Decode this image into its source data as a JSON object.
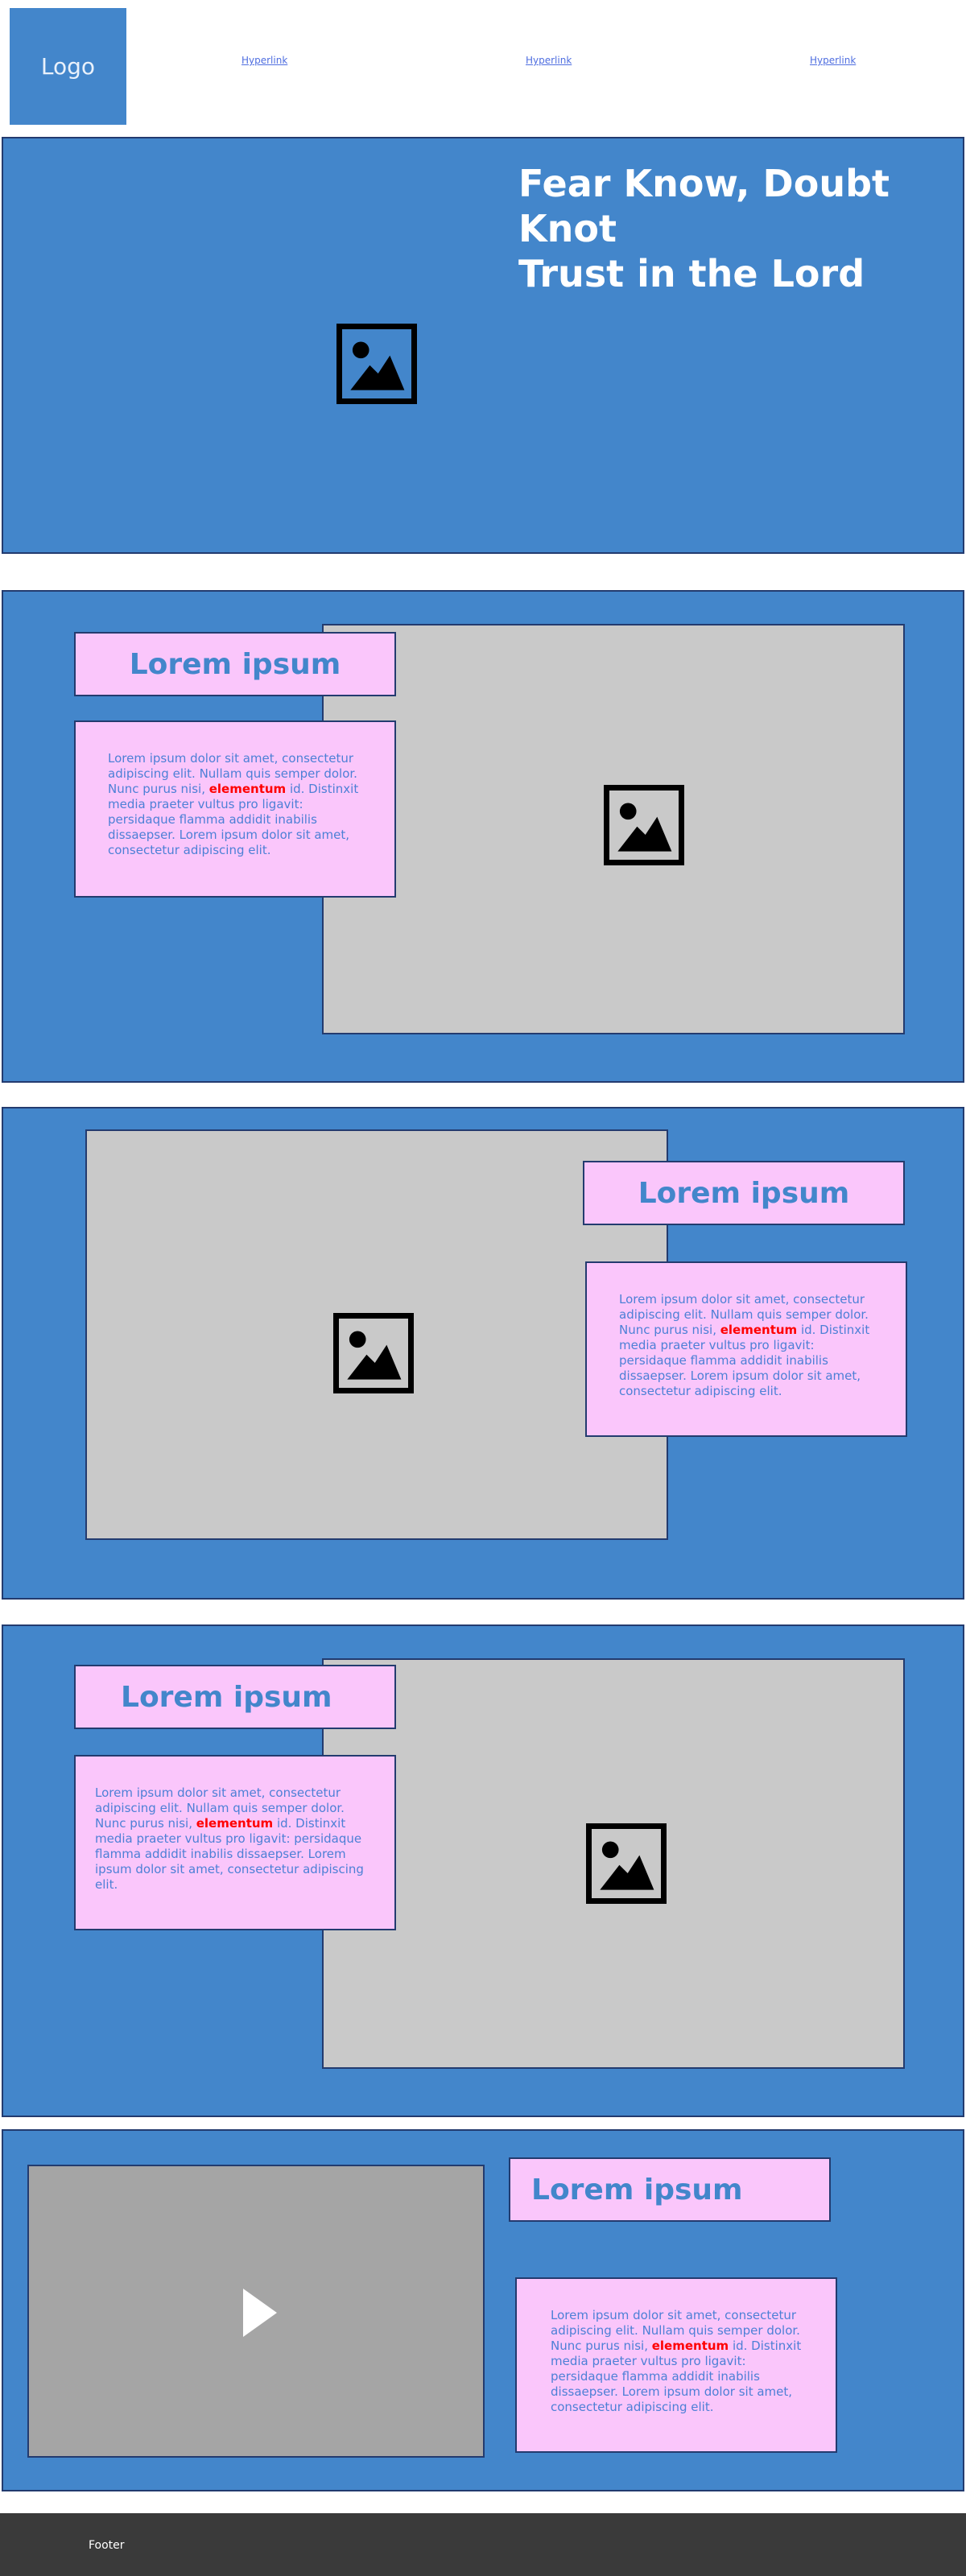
{
  "header": {
    "logo": "Logo",
    "nav": [
      {
        "label": "Hyperlink"
      },
      {
        "label": "Hyperlink"
      },
      {
        "label": "Hyperlink"
      }
    ]
  },
  "hero": {
    "title": "Fear Know, Doubt Knot\nTrust in the Lord"
  },
  "sections": [
    {
      "title": "Lorem ipsum",
      "text_before": "Lorem ipsum dolor sit amet, consectetur adipiscing elit. Nullam quis semper dolor. Nunc purus nisi, ",
      "text_highlight": "elementum",
      "text_after": " id. Distinxit  media praeter vultus pro ligavit: persidaque flamma addidit inabilis dissaepser. Lorem ipsum dolor sit amet, consectetur adipiscing elit."
    },
    {
      "title": "Lorem ipsum",
      "text_before": "Lorem ipsum dolor sit amet, consectetur adipiscing elit. Nullam quis semper dolor. Nunc purus nisi, ",
      "text_highlight": "elementum",
      "text_after": " id. Distinxit  media praeter vultus pro ligavit: persidaque flamma addidit inabilis dissaepser. Lorem ipsum dolor sit amet, consectetur adipiscing elit."
    },
    {
      "title": "Lorem ipsum",
      "text_before": "Lorem ipsum dolor sit amet, consectetur adipiscing elit. Nullam quis semper dolor. Nunc purus nisi, ",
      "text_highlight": "elementum",
      "text_after": " id. Distinxit  media praeter vultus pro ligavit: persidaque flamma addidit inabilis dissaepser. Lorem ipsum dolor sit amet, consectetur adipiscing elit."
    },
    {
      "title": "Lorem ipsum",
      "text_before": "Lorem ipsum dolor sit amet, consectetur adipiscing elit. Nullam quis semper dolor. Nunc purus nisi, ",
      "text_highlight": "elementum",
      "text_after": " id. Distinxit  media praeter vultus pro ligavit: persidaque flamma addidit inabilis dissaepser. Lorem ipsum dolor sit amet, consectetur adipiscing elit."
    }
  ],
  "footer": {
    "text": "Footer"
  },
  "colors": {
    "primary": "#4386cb",
    "panel_border": "#233b6f",
    "card_fill": "#fac6fb",
    "highlight": "#ff0000",
    "footer_bg": "#3a3a3a"
  },
  "icons": {
    "image": "image-placeholder-icon",
    "video": "play-icon"
  }
}
